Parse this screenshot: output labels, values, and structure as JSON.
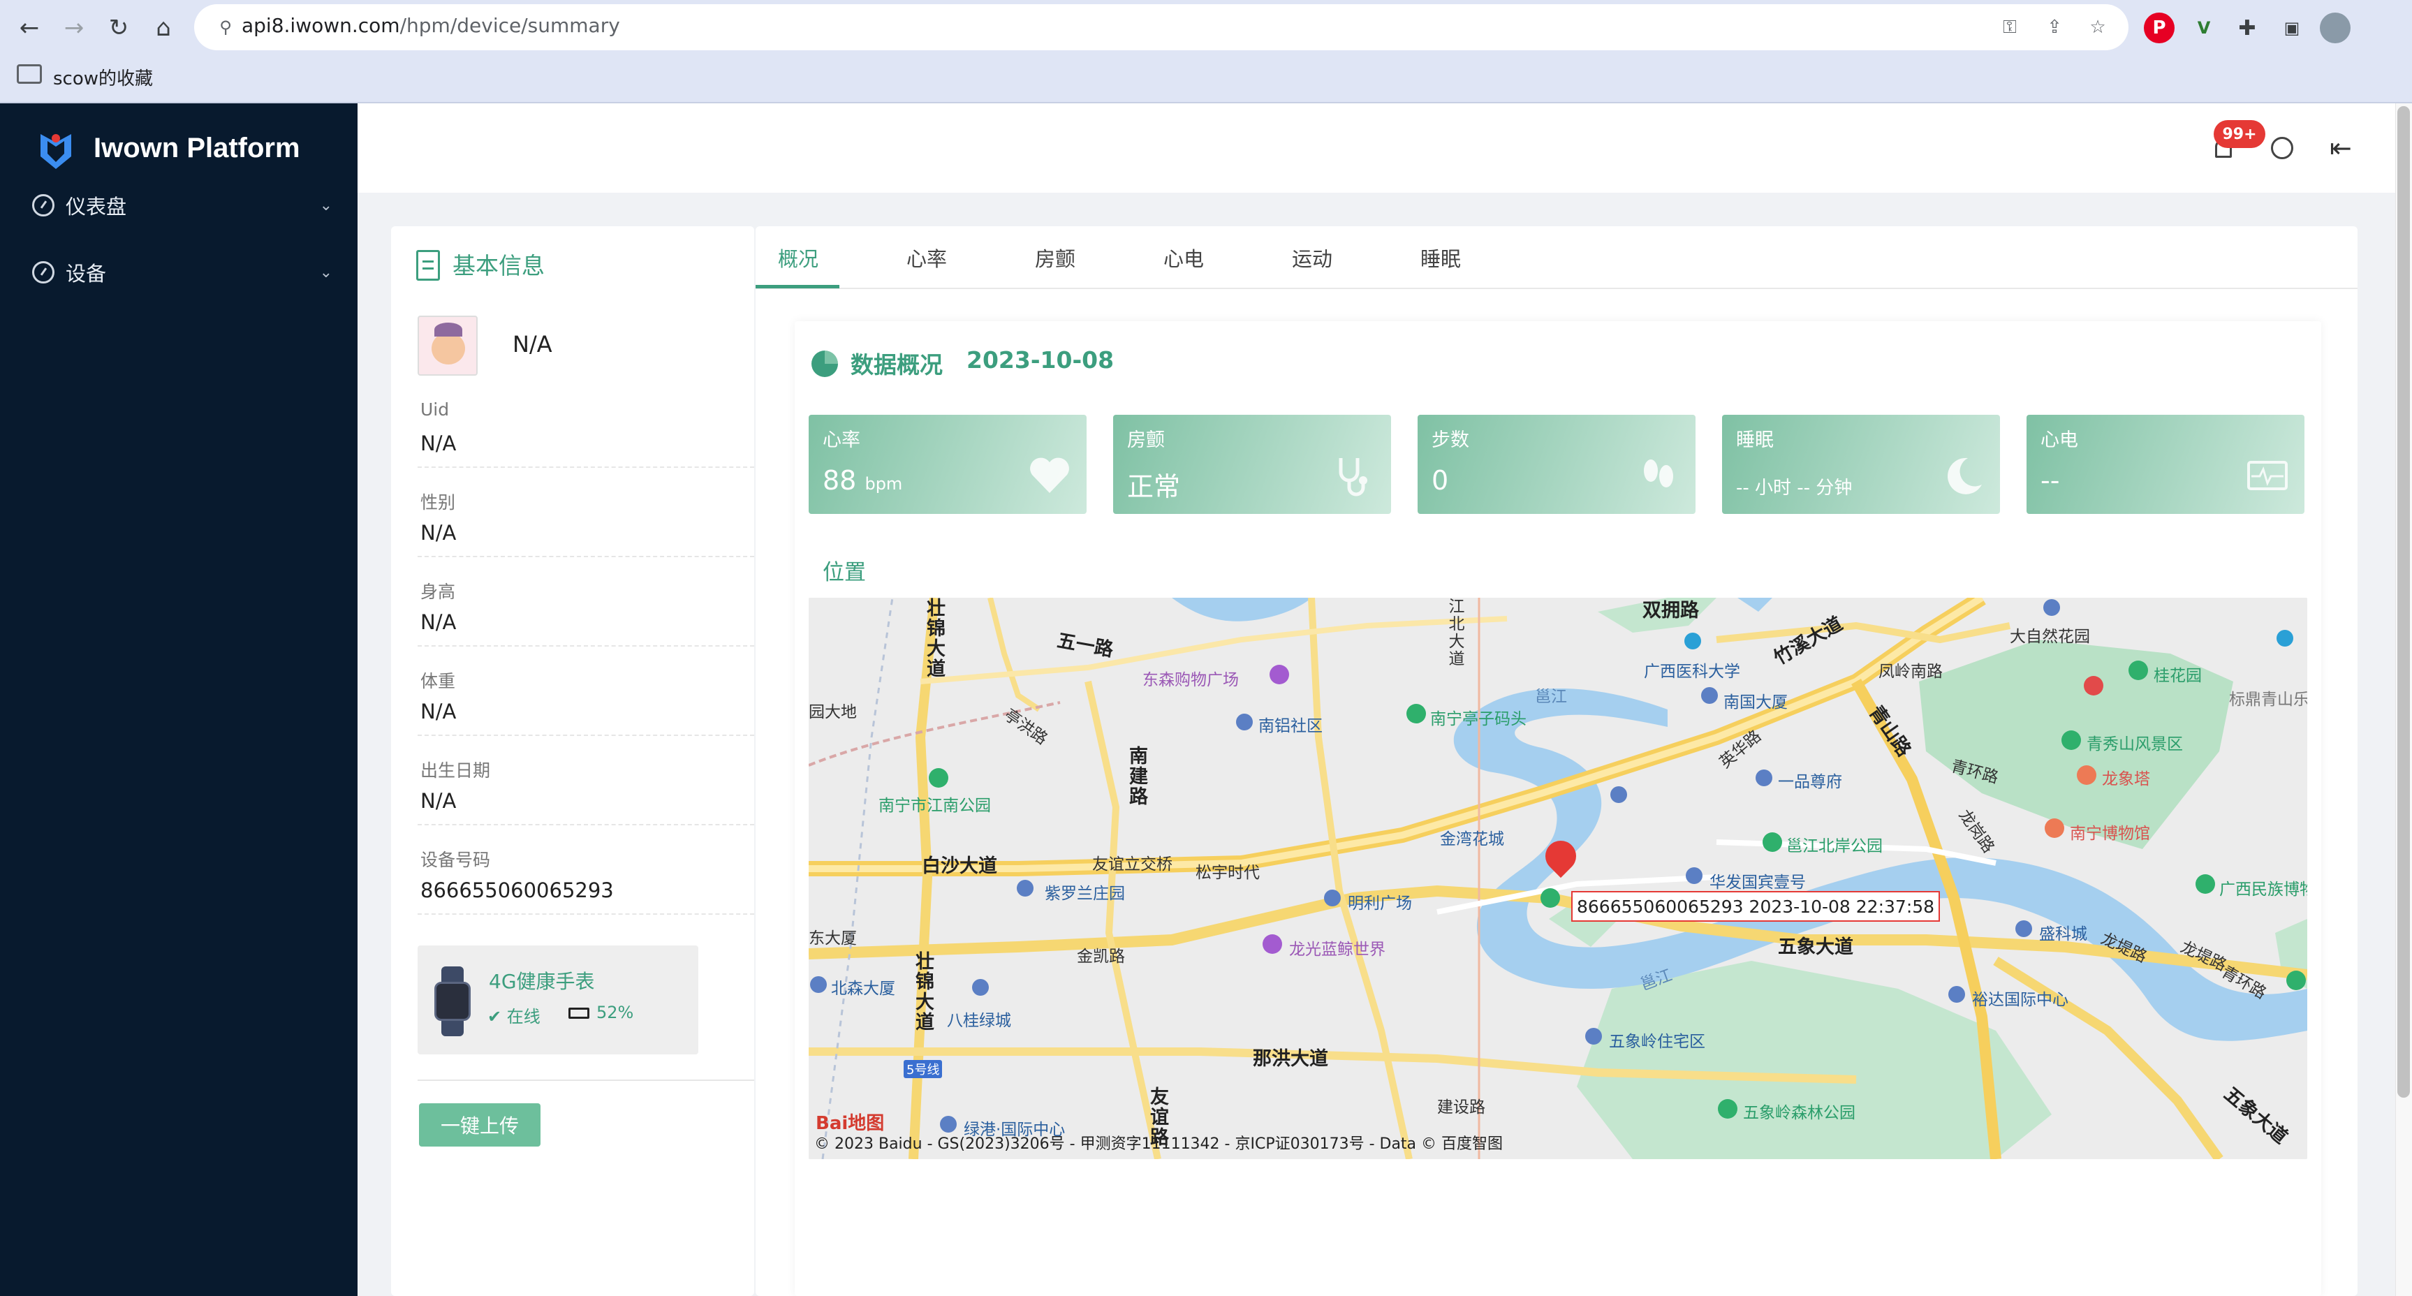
{
  "browser": {
    "url_host": "api8.iwown.com",
    "url_path": "/hpm/device/summary",
    "bookmark_folder": "scow的收藏"
  },
  "sidebar": {
    "app_name": "Iwown Platform",
    "items": [
      {
        "label": "仪表盘"
      },
      {
        "label": "设备"
      }
    ]
  },
  "header": {
    "notification_count": "99+"
  },
  "basic_info": {
    "title": "基本信息",
    "device_name": "N/A",
    "fields": [
      {
        "label": "Uid",
        "value": "N/A"
      },
      {
        "label": "性别",
        "value": "N/A"
      },
      {
        "label": "身高",
        "value": "N/A"
      },
      {
        "label": "体重",
        "value": "N/A"
      },
      {
        "label": "出生日期",
        "value": "N/A"
      },
      {
        "label": "设备号码",
        "value": "866655060065293"
      }
    ],
    "device_type": "4G健康手表",
    "online_status": "在线",
    "battery": "52%",
    "upload_button": "一键上传"
  },
  "tabs": [
    {
      "label": "概况"
    },
    {
      "label": "心率"
    },
    {
      "label": "房颤"
    },
    {
      "label": "心电"
    },
    {
      "label": "运动"
    },
    {
      "label": "睡眠"
    }
  ],
  "summary": {
    "title": "数据概况",
    "date": "2023-10-08",
    "stats": [
      {
        "label": "心率",
        "value": "88",
        "unit": "bpm",
        "icon": "heart-icon"
      },
      {
        "label": "房颤",
        "value": "正常",
        "unit": "",
        "icon": "stethoscope-icon"
      },
      {
        "label": "步数",
        "value": "0",
        "unit": "",
        "icon": "footprints-icon"
      },
      {
        "label": "睡眠",
        "value": "-- 小时 -- 分钟",
        "unit": "",
        "icon": "moon-icon"
      },
      {
        "label": "心电",
        "value": "--",
        "unit": "",
        "icon": "ecg-icon"
      }
    ],
    "location_title": "位置"
  },
  "map": {
    "marker_label": "866655060065293 2023-10-08 22:37:58",
    "copyright": "© 2023 Baidu - GS(2023)3206号 - 甲测资字11111342 - 京ICP证030173号 - Data © 百度智图",
    "logo_text": "Bai地图",
    "labels": {
      "l1": "双拥路",
      "l2": "五一路",
      "l3": "竹溪大道",
      "l4": "凤岭南路",
      "l5": "大自然花园",
      "l6": "桂花园",
      "l7": "标鼎青山乐",
      "l8": "东森购物广场",
      "l9": "南铝社区",
      "l10": "南宁亭子码头",
      "l11": "邕江",
      "l12": "广西医科大学",
      "l13": "南国大厦",
      "l14": "青秀山风景区",
      "l15": "青环路",
      "l16": "龙象塔",
      "l17": "一品尊府",
      "l18": "英华路",
      "l19": "南宁市江南公园",
      "l20": "金湾花城",
      "l21": "邕江北岸公园",
      "l22": "南宁博物馆",
      "l23": "广西民族博物",
      "l24": "白沙大道",
      "l25": "友谊立交桥",
      "l26": "松宇时代",
      "l27": "紫罗兰庄园",
      "l28": "明利广场",
      "l29": "华发国宾壹号",
      "l30": "五象大道",
      "l31": "盛科城",
      "l32": "龙堤路",
      "l33": "金凯路",
      "l34": "龙光蓝鲸世界",
      "l35": "北森大厦",
      "l36": "八桂绿城",
      "l37": "裕达国际中心",
      "l38": "那洪大道",
      "l39": "五象岭住宅区",
      "l40": "建设路",
      "l41": "五象岭森林公园",
      "l42": "5号线",
      "l43": "绿港·国际中心",
      "l44": "五象大道",
      "l45": "壮锦大道",
      "l46": "南建路",
      "l47": "亭洪路",
      "l48": "江北大道",
      "l49": "壮锦大道",
      "l50": "友谊路",
      "l51": "园大地",
      "l52": "东大厦",
      "l53": "龙岗路",
      "l54": "青山路",
      "l55": "龙堤路",
      "l56": "邕江",
      "l57": "青环路"
    }
  }
}
